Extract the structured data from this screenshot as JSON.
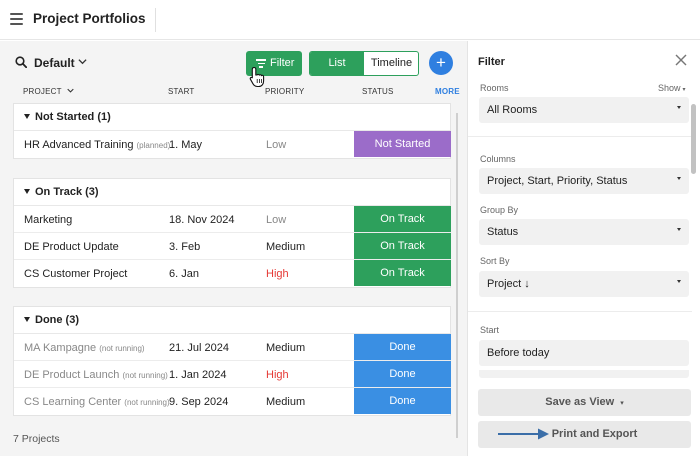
{
  "header": {
    "title": "Project Portfolios"
  },
  "toolbar": {
    "view_name": "Default",
    "filter_label": "Filter",
    "list_label": "List",
    "timeline_label": "Timeline",
    "add_label": "+"
  },
  "columns": {
    "project": "PROJECT",
    "start": "START",
    "priority": "PRIORITY",
    "status": "STATUS",
    "more": "MORE"
  },
  "groups": [
    {
      "title": "Not Started (1)",
      "rows": [
        {
          "name": "HR Advanced Training",
          "note": "(planned)",
          "start": "1. May",
          "priority": "Low",
          "status": "Not Started"
        }
      ]
    },
    {
      "title": "On Track (3)",
      "rows": [
        {
          "name": "Marketing",
          "note": "",
          "start": "18. Nov 2024",
          "priority": "Low",
          "status": "On Track"
        },
        {
          "name": "DE Product Update",
          "note": "",
          "start": "3. Feb",
          "priority": "Medium",
          "status": "On Track"
        },
        {
          "name": "CS Customer Project",
          "note": "",
          "start": "6. Jan",
          "priority": "High",
          "status": "On Track"
        }
      ]
    },
    {
      "title": "Done (3)",
      "rows": [
        {
          "name": "MA Kampagne",
          "note": "(not running)",
          "start": "21. Jul 2024",
          "priority": "Medium",
          "status": "Done"
        },
        {
          "name": "DE Product Launch",
          "note": "(not running)",
          "start": "1. Jan 2024",
          "priority": "High",
          "status": "Done"
        },
        {
          "name": "CS Learning Center",
          "note": "(not running)",
          "start": "9. Sep 2024",
          "priority": "Medium",
          "status": "Done"
        }
      ]
    }
  ],
  "footer": {
    "count": "7 Projects"
  },
  "filter_panel": {
    "title": "Filter",
    "rooms_label": "Rooms",
    "rooms_show": "Show",
    "rooms_value": "All Rooms",
    "columns_label": "Columns",
    "columns_value": "Project, Start, Priority, Status",
    "groupby_label": "Group By",
    "groupby_value": "Status",
    "sortby_label": "Sort By",
    "sortby_value": "Project ↓",
    "start_label": "Start",
    "start_value": "Before today",
    "save_view_label": "Save as View",
    "print_export_label": "Print and Export"
  },
  "colors": {
    "green": "#2da05c",
    "blue_done": "#3a8fe3",
    "purple": "#9b6cc9",
    "add_blue": "#2f7fe0",
    "high_red": "#e53935",
    "arrow_blue": "#3b6ea8"
  },
  "icons": {
    "menu": "hamburger-icon",
    "search": "search-icon",
    "filter": "filter-lines-icon",
    "close": "close-icon"
  }
}
